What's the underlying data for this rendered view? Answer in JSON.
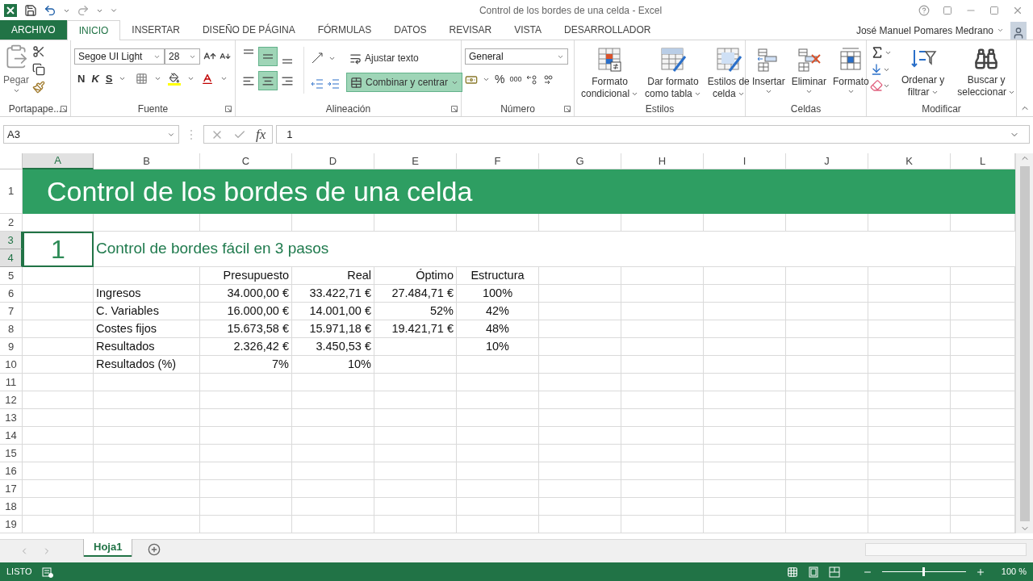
{
  "window": {
    "title": "Control de los bordes de una celda - Excel"
  },
  "ribbon_tabs": [
    {
      "label": "ARCHIVO",
      "kind": "file",
      "selected": false
    },
    {
      "label": "INICIO",
      "kind": "tab",
      "selected": true
    },
    {
      "label": "INSERTAR",
      "kind": "tab",
      "selected": false
    },
    {
      "label": "DISEÑO DE PÁGINA",
      "kind": "tab",
      "selected": false
    },
    {
      "label": "FÓRMULAS",
      "kind": "tab",
      "selected": false
    },
    {
      "label": "DATOS",
      "kind": "tab",
      "selected": false
    },
    {
      "label": "REVISAR",
      "kind": "tab",
      "selected": false
    },
    {
      "label": "VISTA",
      "kind": "tab",
      "selected": false
    },
    {
      "label": "DESARROLLADOR",
      "kind": "tab",
      "selected": false
    }
  ],
  "user": {
    "name": "José Manuel Pomares Medrano"
  },
  "clipboard": {
    "paste": "Pegar",
    "label": "Portapape..."
  },
  "font": {
    "family": "Segoe UI Light",
    "size": "28",
    "bold": "N",
    "italic": "K",
    "underline": "S",
    "label": "Fuente"
  },
  "alignment": {
    "vertical": [
      {
        "selected": false
      },
      {
        "selected": true
      },
      {
        "selected": false
      }
    ],
    "horizontal": [
      {
        "selected": false
      },
      {
        "selected": true
      },
      {
        "selected": false
      }
    ],
    "wrap": "Ajustar texto",
    "merge": {
      "label": "Combinar y centrar",
      "selected": true
    },
    "label": "Alineación"
  },
  "number": {
    "format": "General",
    "percent": "%",
    "thousands": "000",
    "label": "Número"
  },
  "styles": {
    "buttons": [
      {
        "lines": [
          "Formato",
          "condicional"
        ]
      },
      {
        "lines": [
          "Dar formato",
          "como tabla"
        ]
      },
      {
        "lines": [
          "Estilos de",
          "celda"
        ]
      }
    ],
    "label": "Estilos"
  },
  "cells_group": {
    "buttons": [
      "Insertar",
      "Eliminar",
      "Formato"
    ],
    "label": "Celdas"
  },
  "editing": {
    "buttons": [
      {
        "lines": [
          "Ordenar y",
          "filtrar"
        ]
      },
      {
        "lines": [
          "Buscar y",
          "seleccionar"
        ]
      }
    ],
    "label": "Modificar"
  },
  "formula_bar": {
    "name_box": "A3",
    "function_label": "fx",
    "value": "1"
  },
  "sheet": {
    "columns": [
      {
        "label": "A",
        "selected": true
      },
      {
        "label": "B",
        "selected": false
      },
      {
        "label": "C",
        "selected": false
      },
      {
        "label": "D",
        "selected": false
      },
      {
        "label": "E",
        "selected": false
      },
      {
        "label": "F",
        "selected": false
      },
      {
        "label": "G",
        "selected": false
      },
      {
        "label": "H",
        "selected": false
      },
      {
        "label": "I",
        "selected": false
      },
      {
        "label": "J",
        "selected": false
      },
      {
        "label": "K",
        "selected": false
      },
      {
        "label": "L",
        "selected": false
      }
    ],
    "rows": [
      {
        "number": "1",
        "selected": false
      },
      {
        "number": "2",
        "selected": false
      },
      {
        "number": "3",
        "selected": true
      },
      {
        "number": "4",
        "selected": true
      },
      {
        "number": "5",
        "selected": false
      },
      {
        "number": "6",
        "selected": false
      },
      {
        "number": "7",
        "selected": false
      },
      {
        "number": "8",
        "selected": false
      },
      {
        "number": "9",
        "selected": false
      },
      {
        "number": "10",
        "selected": false
      },
      {
        "number": "11",
        "selected": false
      },
      {
        "number": "12",
        "selected": false
      },
      {
        "number": "13",
        "selected": false
      },
      {
        "number": "14",
        "selected": false
      },
      {
        "number": "15",
        "selected": false
      },
      {
        "number": "16",
        "selected": false
      },
      {
        "number": "17",
        "selected": false
      },
      {
        "number": "18",
        "selected": false
      },
      {
        "number": "19",
        "selected": false
      }
    ],
    "title": "Control de los bordes de una celda",
    "active_cell": {
      "text": "1",
      "selected": true
    },
    "subtitle": "Control de bordes fácil en 3 pasos",
    "table": {
      "headers": [
        "Presupuesto",
        "Real",
        "Óptimo",
        "Estructura"
      ],
      "rows": [
        {
          "label": "Ingresos",
          "presupuesto": "34.000,00 €",
          "real": "33.422,71 €",
          "optimo": "27.484,71 €",
          "estructura": "100%"
        },
        {
          "label": "C. Variables",
          "presupuesto": "16.000,00 €",
          "real": "14.001,00 €",
          "optimo": "52%",
          "estructura": "42%"
        },
        {
          "label": "Costes fijos",
          "presupuesto": "15.673,58 €",
          "real": "15.971,18 €",
          "optimo": "19.421,71 €",
          "estructura": "48%"
        },
        {
          "label": "Resultados",
          "presupuesto": "2.326,42 €",
          "real": "3.450,53 €",
          "estructura": "10%"
        },
        {
          "label": "Resultados (%)",
          "presupuesto": "7%",
          "real": "10%"
        }
      ]
    }
  },
  "sheet_tabs": [
    {
      "label": "Hoja1",
      "selected": true
    }
  ],
  "status_bar": {
    "status": "LISTO",
    "zoom": "100 %",
    "zoom_slider": {
      "level": 0.5
    }
  }
}
